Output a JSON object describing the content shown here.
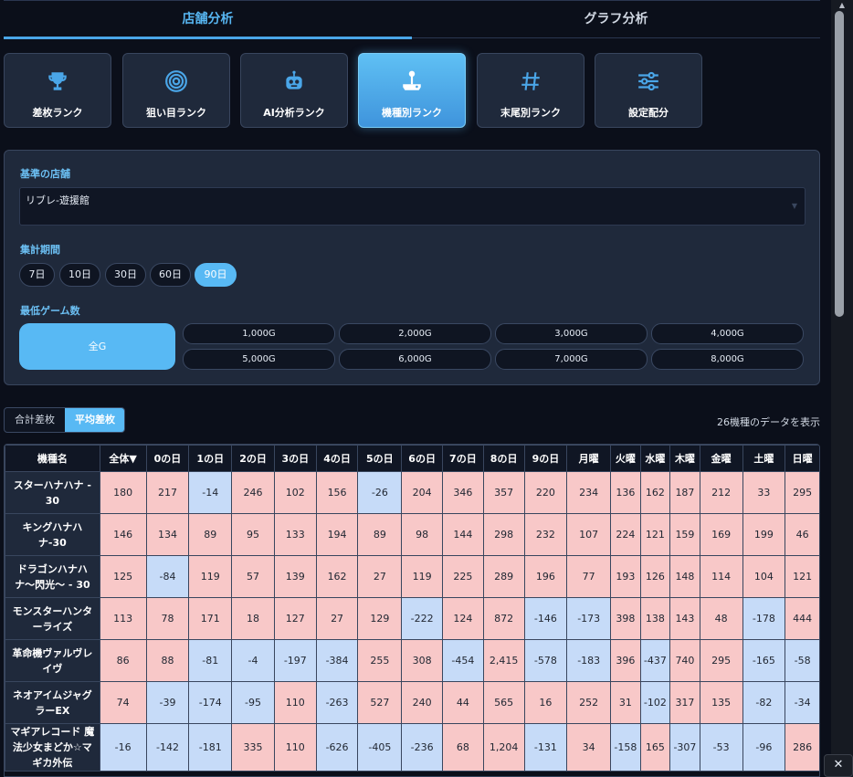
{
  "tabs": [
    "店舗分析",
    "グラフ分析"
  ],
  "rank_buttons": [
    {
      "label": "差枚ランク",
      "icon": "trophy-icon"
    },
    {
      "label": "狙い目ランク",
      "icon": "target-icon"
    },
    {
      "label": "AI分析ランク",
      "icon": "robot-icon"
    },
    {
      "label": "機種別ランク",
      "icon": "joystick-icon"
    },
    {
      "label": "末尾別ランク",
      "icon": "hash-icon"
    },
    {
      "label": "設定配分",
      "icon": "sliders-icon"
    }
  ],
  "active_rank": "機種別ランク",
  "filters": {
    "store_label": "基準の店舗",
    "store_value": "リブレ-遊援館",
    "period_label": "集計期間",
    "periods": [
      "7日",
      "10日",
      "30日",
      "60日",
      "90日"
    ],
    "active_period": "90日",
    "min_games_label": "最低ゲーム数",
    "all_games": "全G",
    "games_row1": [
      "1,000G",
      "2,000G",
      "3,000G",
      "4,000G"
    ],
    "games_row2": [
      "5,000G",
      "6,000G",
      "7,000G",
      "8,000G"
    ]
  },
  "toggle": {
    "options": [
      "合計差枚",
      "平均差枚"
    ],
    "active": "平均差枚"
  },
  "count_text": "26機種のデータを表示",
  "table": {
    "headers": [
      "機種名",
      "全体▼",
      "0の日",
      "1の日",
      "2の日",
      "3の日",
      "4の日",
      "5の日",
      "6の日",
      "7の日",
      "8の日",
      "9の日",
      "月曜",
      "火曜",
      "水曜",
      "木曜",
      "金曜",
      "土曜",
      "日曜"
    ],
    "rows": [
      {
        "name": "スターハナハナ - 30",
        "values": [
          "180",
          "217",
          "-14",
          "246",
          "102",
          "156",
          "-26",
          "204",
          "346",
          "357",
          "220",
          "234",
          "136",
          "162",
          "187",
          "212",
          "33",
          "295"
        ]
      },
      {
        "name": "キングハナハナ-30",
        "values": [
          "146",
          "134",
          "89",
          "95",
          "133",
          "194",
          "89",
          "98",
          "144",
          "298",
          "232",
          "107",
          "224",
          "121",
          "159",
          "169",
          "199",
          "46"
        ]
      },
      {
        "name": "ドラゴンハナハナ〜閃光〜 - 30",
        "values": [
          "125",
          "-84",
          "119",
          "57",
          "139",
          "162",
          "27",
          "119",
          "225",
          "289",
          "196",
          "77",
          "193",
          "126",
          "148",
          "114",
          "104",
          "121"
        ]
      },
      {
        "name": "モンスターハンターライズ",
        "values": [
          "113",
          "78",
          "171",
          "18",
          "127",
          "27",
          "129",
          "-222",
          "124",
          "872",
          "-146",
          "-173",
          "398",
          "138",
          "143",
          "48",
          "-178",
          "444"
        ]
      },
      {
        "name": "革命機ヴァルヴレイヴ",
        "values": [
          "86",
          "88",
          "-81",
          "-4",
          "-197",
          "-384",
          "255",
          "308",
          "-454",
          "2,415",
          "-578",
          "-183",
          "396",
          "-437",
          "740",
          "295",
          "-165",
          "-58"
        ]
      },
      {
        "name": "ネオアイムジャグラーEX",
        "values": [
          "74",
          "-39",
          "-174",
          "-95",
          "110",
          "-263",
          "527",
          "240",
          "44",
          "565",
          "16",
          "252",
          "31",
          "-102",
          "317",
          "135",
          "-82",
          "-34"
        ]
      },
      {
        "name": "マギアレコード 魔法少女まどか☆マギカ外伝",
        "values": [
          "-16",
          "-142",
          "-181",
          "335",
          "110",
          "-626",
          "-405",
          "-236",
          "68",
          "1,204",
          "-131",
          "34",
          "-158",
          "165",
          "-307",
          "-53",
          "-96",
          "286"
        ]
      }
    ]
  },
  "colors": {
    "positive_cell": "#f8c8c8",
    "negative_cell": "#c6dbf8",
    "accent": "#58b9f4"
  }
}
